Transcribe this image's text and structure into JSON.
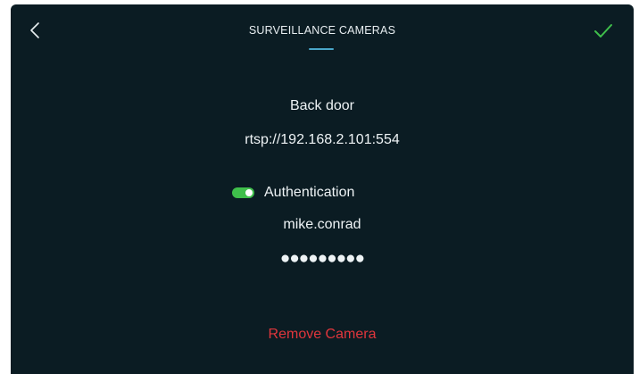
{
  "header": {
    "title": "SURVEILLANCE CAMERAS",
    "back_icon": "chevron-left-icon",
    "confirm_icon": "checkmark-icon"
  },
  "camera": {
    "name": "Back door",
    "url": "rtsp://192.168.2.101:554"
  },
  "authentication": {
    "label": "Authentication",
    "enabled": true,
    "username": "mike.conrad",
    "password_masked": "●●●●●●●●●"
  },
  "actions": {
    "remove_label": "Remove Camera"
  },
  "colors": {
    "background": "#0b1c23",
    "accent": "#4aa6c9",
    "toggle_on": "#3fbf4b",
    "confirm": "#3fbf4b",
    "danger": "#e0363c"
  }
}
